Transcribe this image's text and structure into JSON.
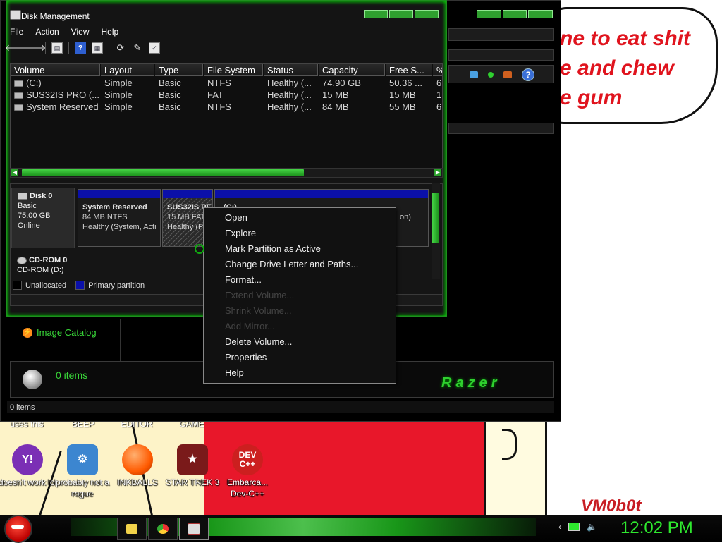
{
  "wallpaper": {
    "bubble_text": "ne to eat shit\ne and chew\ne gum",
    "signature": "VM0b0t"
  },
  "desktop": {
    "top_labels": [
      "uses this",
      "BEEP",
      "EDITOR",
      "GAME"
    ],
    "icons": [
      {
        "label": "doesn't work lol",
        "icon": "yahoo-messenger-icon",
        "color": "#7b2fb5",
        "glyph": "Y!"
      },
      {
        "label": "probably not a rogue",
        "icon": "gears-app-icon",
        "color": "#3c86d0",
        "glyph": "⚙"
      },
      {
        "label": "INKBALLS",
        "icon": "inkball-icon",
        "color": "#ff6a00",
        "glyph": "●"
      },
      {
        "label": "STAR TREK 3",
        "icon": "star-trek-game-icon",
        "color": "#7a1a1a",
        "glyph": "★"
      },
      {
        "label": "Embarca... Dev-C++",
        "icon": "dev-cpp-icon",
        "color": "#cc1f1f",
        "glyph": "DEV C++"
      }
    ]
  },
  "explorer": {
    "image_catalog": "Image Catalog",
    "items_count": "0 items",
    "status": "0 items",
    "brand": "Razer"
  },
  "disk_mgmt": {
    "title": "Disk Management",
    "menu": [
      "File",
      "Action",
      "View",
      "Help"
    ],
    "columns": [
      "Volume",
      "Layout",
      "Type",
      "File System",
      "Status",
      "Capacity",
      "Free S...",
      "%"
    ],
    "rows": [
      [
        "(C:)",
        "Simple",
        "Basic",
        "NTFS",
        "Healthy (...",
        "74.90 GB",
        "50.36 ...",
        "6"
      ],
      [
        "SUS32IS PRO (...",
        "Simple",
        "Basic",
        "FAT",
        "Healthy (...",
        "15 MB",
        "15 MB",
        "1"
      ],
      [
        "System Reserved",
        "Simple",
        "Basic",
        "NTFS",
        "Healthy (...",
        "84 MB",
        "55 MB",
        "6"
      ]
    ],
    "disk0": {
      "name": "Disk 0",
      "type": "Basic",
      "size": "75.00 GB",
      "status": "Online"
    },
    "partitions": [
      {
        "name": "System Reserved",
        "size": "84 MB NTFS",
        "status": "Healthy (System, Acti"
      },
      {
        "name": "SUS32IS PF",
        "size": "15 MB FAT",
        "status": "Healthy (Pr"
      },
      {
        "name": "(C:)",
        "size": "",
        "status": "on)"
      }
    ],
    "cdrom": {
      "name": "CD-ROM 0",
      "sub": "CD-ROM (D:)"
    },
    "legend": {
      "unallocated": "Unallocated",
      "primary": "Primary partition"
    }
  },
  "context_menu": {
    "items": [
      {
        "label": "Open",
        "enabled": true
      },
      {
        "label": "Explore",
        "enabled": true
      },
      {
        "label": "Mark Partition as Active",
        "enabled": true
      },
      {
        "label": "Change Drive Letter and Paths...",
        "enabled": true
      },
      {
        "label": "Format...",
        "enabled": true
      },
      {
        "label": "Extend Volume...",
        "enabled": false
      },
      {
        "label": "Shrink Volume...",
        "enabled": false
      },
      {
        "label": "Add Mirror...",
        "enabled": false
      },
      {
        "label": "Delete Volume...",
        "enabled": true
      },
      {
        "label": "Properties",
        "enabled": true
      },
      {
        "label": "Help",
        "enabled": true
      }
    ]
  },
  "taskbar": {
    "clock": "12:02 PM"
  },
  "colors": {
    "accent_green": "#2ee82e",
    "partition_blue": "#0b10a8",
    "bubble_red": "#e0141e"
  }
}
